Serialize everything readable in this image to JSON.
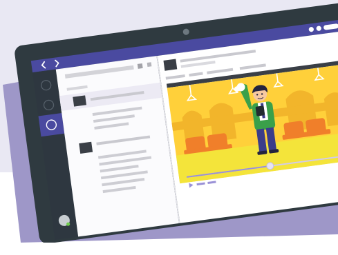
{
  "colors": {
    "background_top": "#e9e8f3",
    "backdrop_card": "#9e97c8",
    "tablet_frame": "#2f3a40",
    "titlebar": "#4a4aa0",
    "rail": "#2e3740",
    "rail_active": "#4a4aa0",
    "list_panel": "#fbfbfd",
    "list_selected": "#eceaf4",
    "placeholder_line": "#c9c9cf",
    "placeholder_dark": "#3a3f46",
    "video_sky": "#ffd03a",
    "video_building": "#f2b52b",
    "video_seats": "#f07f2a",
    "video_floor": "#f4e43a",
    "person_shirt": "#3aa04a",
    "person_pants": "#3b3d8a",
    "person_hair": "#23233e",
    "control_bar": "#dcd6f2",
    "presence_green": "#6ecb4d"
  },
  "icons": {
    "back": "chevron-left-icon",
    "forward": "chevron-right-icon",
    "window_controls": "window-dots-icon",
    "camera": "camera-lens-icon",
    "play": "play-icon",
    "nav_items": [
      "nav-circle-icon",
      "nav-circle-icon",
      "nav-circle-icon"
    ],
    "avatar": "user-avatar-icon"
  },
  "media": {
    "playback_progress": 0.42
  }
}
